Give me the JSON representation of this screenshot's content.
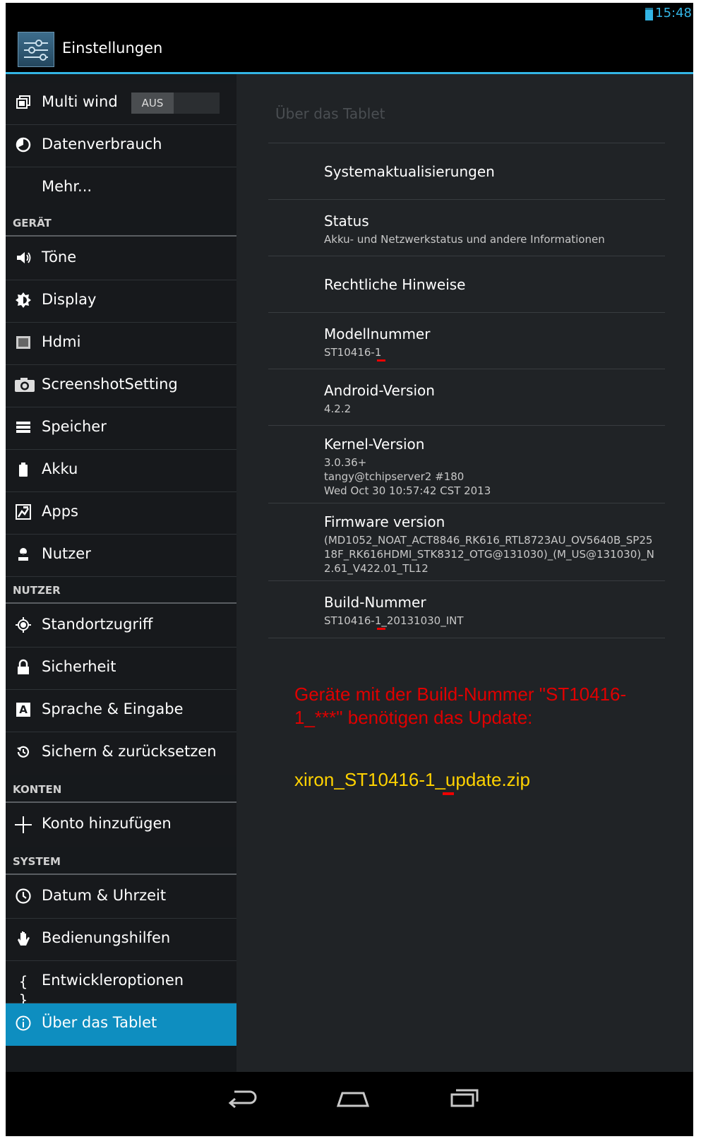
{
  "statusbar": {
    "time": "15:48"
  },
  "actionbar": {
    "title": "Einstellungen"
  },
  "sidebar": {
    "multi_window": {
      "label": "Multi wind",
      "toggle": "AUS"
    },
    "data_usage": "Datenverbrauch",
    "more": "Mehr...",
    "sec_device": "GERÄT",
    "sounds": "Töne",
    "display": "Display",
    "hdmi": "Hdmi",
    "screenshot": "ScreenshotSetting",
    "storage": "Speicher",
    "battery": "Akku",
    "apps": "Apps",
    "users": "Nutzer",
    "sec_user": "NUTZER",
    "location": "Standortzugriff",
    "security": "Sicherheit",
    "language": "Sprache & Eingabe",
    "backup": "Sichern & zurücksetzen",
    "sec_accounts": "KONTEN",
    "add_account": "Konto hinzufügen",
    "sec_system": "SYSTEM",
    "datetime": "Datum & Uhrzeit",
    "accessibility": "Bedienungshilfen",
    "developer": "Entwickleroptionen",
    "about": "Über das Tablet"
  },
  "content": {
    "breadcrumb": "Über das Tablet",
    "system_updates": "Systemaktualisierungen",
    "status_title": "Status",
    "status_sub": "Akku- und Netzwerkstatus und andere Informationen",
    "legal": "Rechtliche Hinweise",
    "model_title": "Modellnummer",
    "model_value": "ST10416-1",
    "android_title": "Android-Version",
    "android_value": "4.2.2",
    "kernel_title": "Kernel-Version",
    "kernel_line1": "3.0.36+",
    "kernel_line2": "tangy@tchipserver2 #180",
    "kernel_line3": "Wed Oct 30 10:57:42 CST 2013",
    "firmware_title": "Firmware version",
    "firmware_value": "(MD1052_NOAT_ACT8846_RK616_RTL8723AU_OV5640B_SP2518F_RK616HDMI_STK8312_OTG@131030)_(M_US@131030)_N2.61_V422.01_TL12",
    "build_title": "Build-Nummer",
    "build_value": "ST10416-1_20131030_INT"
  },
  "annotation": {
    "note": "Geräte mit der Build-Nummer \"ST10416-1_***\" benötigen das Update:",
    "filename": "xiron_ST10416-1_update.zip",
    "note_color": "#e00000",
    "filename_color": "#ffd200"
  },
  "colors": {
    "accent": "#33b5e5",
    "active_item": "#0e8ec0"
  },
  "navbar": {
    "icons": [
      "back-icon",
      "home-icon",
      "recent-apps-icon"
    ]
  }
}
